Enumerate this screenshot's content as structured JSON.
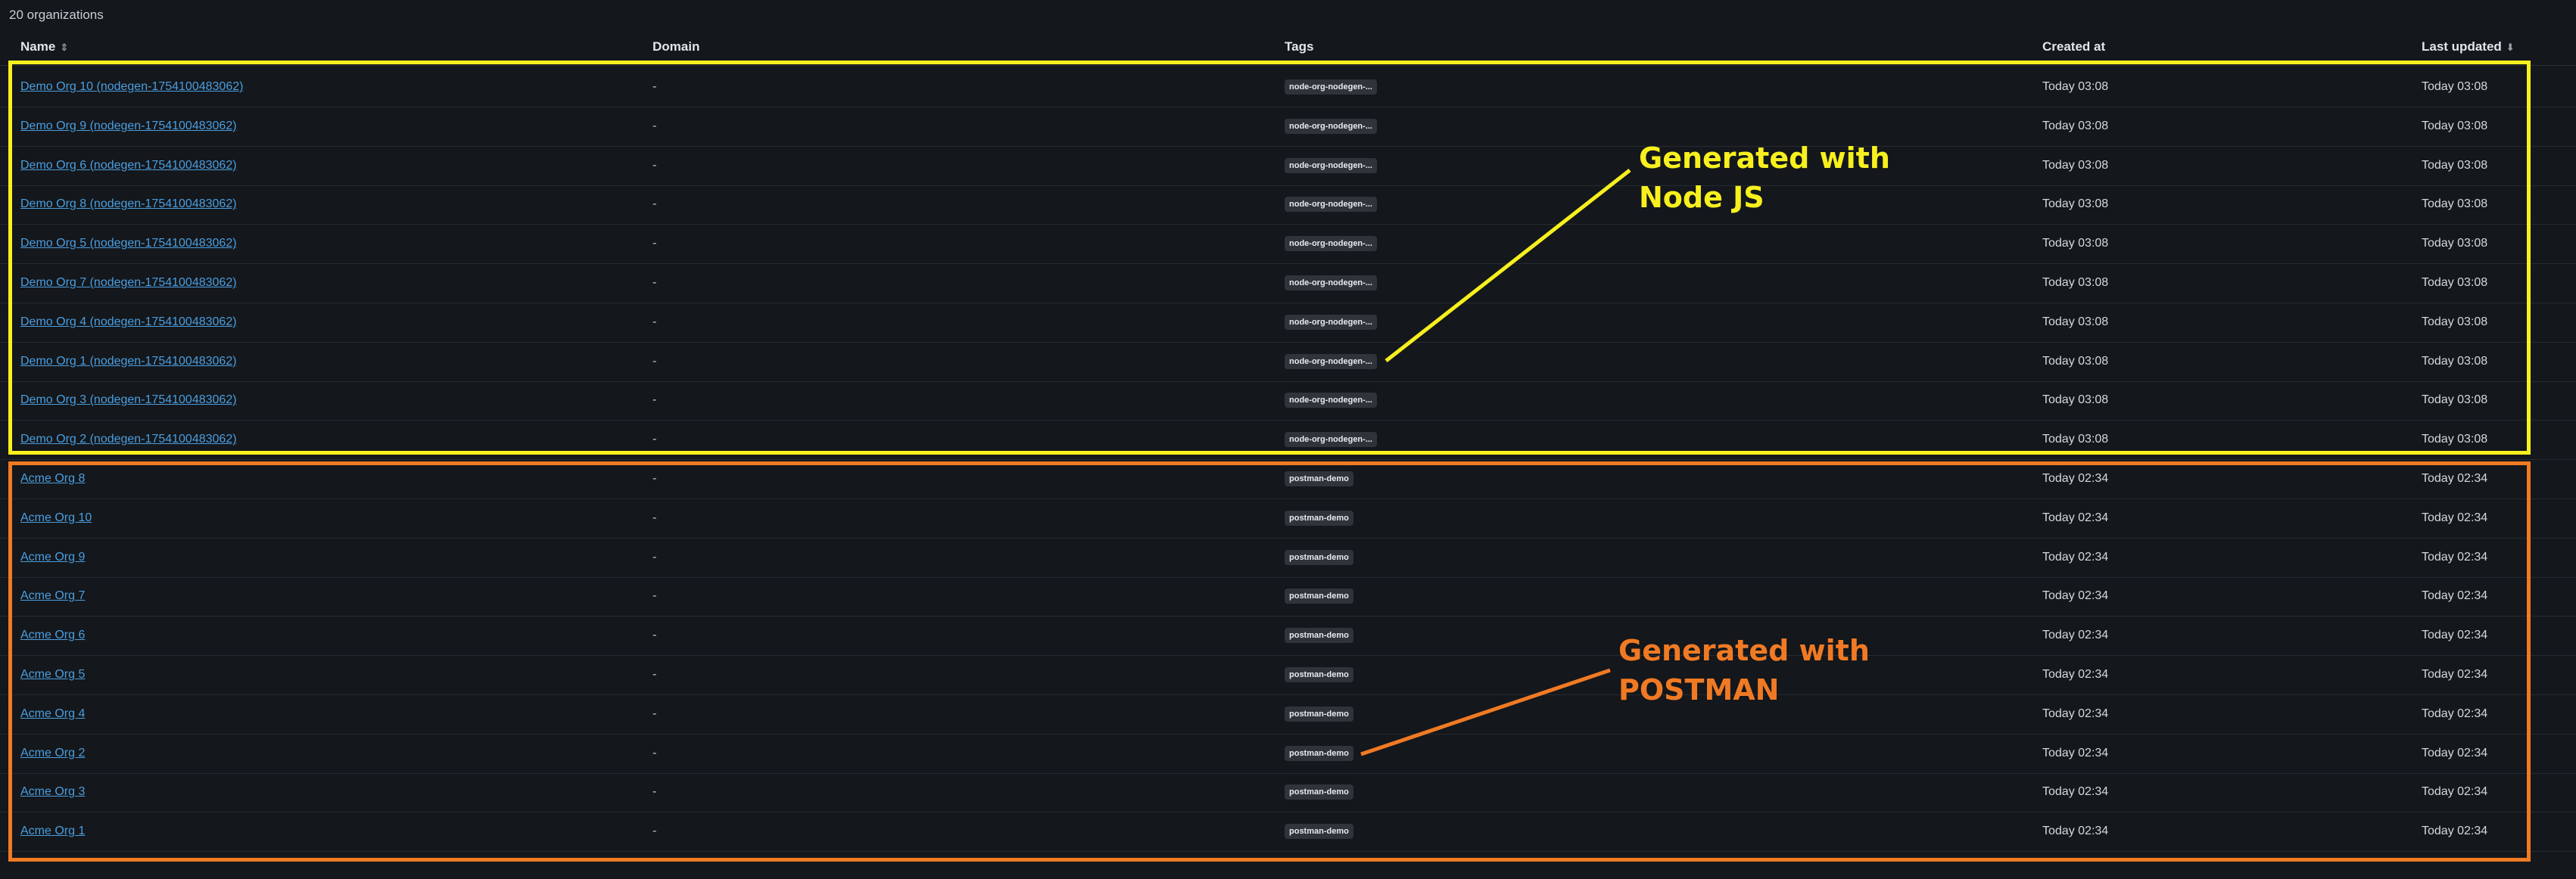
{
  "org_count": "20 organizations",
  "columns": {
    "name": "Name",
    "domain": "Domain",
    "tags": "Tags",
    "created_at": "Created at",
    "last_updated": "Last updated"
  },
  "rows": [
    {
      "name": "Demo Org 10 (nodegen-1754100483062)",
      "domain": "-",
      "tag": "node-org-nodegen-...",
      "created": "Today 03:08",
      "updated": "Today 03:08"
    },
    {
      "name": "Demo Org 9 (nodegen-1754100483062)",
      "domain": "-",
      "tag": "node-org-nodegen-...",
      "created": "Today 03:08",
      "updated": "Today 03:08"
    },
    {
      "name": "Demo Org 6 (nodegen-1754100483062)",
      "domain": "-",
      "tag": "node-org-nodegen-...",
      "created": "Today 03:08",
      "updated": "Today 03:08"
    },
    {
      "name": "Demo Org 8 (nodegen-1754100483062)",
      "domain": "-",
      "tag": "node-org-nodegen-...",
      "created": "Today 03:08",
      "updated": "Today 03:08"
    },
    {
      "name": "Demo Org 5 (nodegen-1754100483062)",
      "domain": "-",
      "tag": "node-org-nodegen-...",
      "created": "Today 03:08",
      "updated": "Today 03:08"
    },
    {
      "name": "Demo Org 7 (nodegen-1754100483062)",
      "domain": "-",
      "tag": "node-org-nodegen-...",
      "created": "Today 03:08",
      "updated": "Today 03:08"
    },
    {
      "name": "Demo Org 4 (nodegen-1754100483062)",
      "domain": "-",
      "tag": "node-org-nodegen-...",
      "created": "Today 03:08",
      "updated": "Today 03:08"
    },
    {
      "name": "Demo Org 1 (nodegen-1754100483062)",
      "domain": "-",
      "tag": "node-org-nodegen-...",
      "created": "Today 03:08",
      "updated": "Today 03:08"
    },
    {
      "name": "Demo Org 3 (nodegen-1754100483062)",
      "domain": "-",
      "tag": "node-org-nodegen-...",
      "created": "Today 03:08",
      "updated": "Today 03:08"
    },
    {
      "name": "Demo Org 2 (nodegen-1754100483062)",
      "domain": "-",
      "tag": "node-org-nodegen-...",
      "created": "Today 03:08",
      "updated": "Today 03:08"
    },
    {
      "name": "Acme Org 8",
      "domain": "-",
      "tag": "postman-demo",
      "created": "Today 02:34",
      "updated": "Today 02:34"
    },
    {
      "name": "Acme Org 10",
      "domain": "-",
      "tag": "postman-demo",
      "created": "Today 02:34",
      "updated": "Today 02:34"
    },
    {
      "name": "Acme Org 9",
      "domain": "-",
      "tag": "postman-demo",
      "created": "Today 02:34",
      "updated": "Today 02:34"
    },
    {
      "name": "Acme Org 7",
      "domain": "-",
      "tag": "postman-demo",
      "created": "Today 02:34",
      "updated": "Today 02:34"
    },
    {
      "name": "Acme Org 6",
      "domain": "-",
      "tag": "postman-demo",
      "created": "Today 02:34",
      "updated": "Today 02:34"
    },
    {
      "name": "Acme Org 5",
      "domain": "-",
      "tag": "postman-demo",
      "created": "Today 02:34",
      "updated": "Today 02:34"
    },
    {
      "name": "Acme Org 4",
      "domain": "-",
      "tag": "postman-demo",
      "created": "Today 02:34",
      "updated": "Today 02:34"
    },
    {
      "name": "Acme Org 2",
      "domain": "-",
      "tag": "postman-demo",
      "created": "Today 02:34",
      "updated": "Today 02:34"
    },
    {
      "name": "Acme Org 3",
      "domain": "-",
      "tag": "postman-demo",
      "created": "Today 02:34",
      "updated": "Today 02:34"
    },
    {
      "name": "Acme Org 1",
      "domain": "-",
      "tag": "postman-demo",
      "created": "Today 02:34",
      "updated": "Today 02:34"
    }
  ],
  "annotations": {
    "node": {
      "line1": "Generated with",
      "line2": "Node JS",
      "color": "#f7f01e"
    },
    "postman": {
      "line1": "Generated with",
      "line2": "POSTMAN",
      "color": "#f07a24"
    }
  },
  "colors": {
    "background": "#14171b",
    "link": "#4a9ee0",
    "tag_bg": "#2f343b"
  },
  "icons": {
    "name_sort": "sort-updown-icon",
    "last_updated_sort": "sort-descending-icon"
  }
}
